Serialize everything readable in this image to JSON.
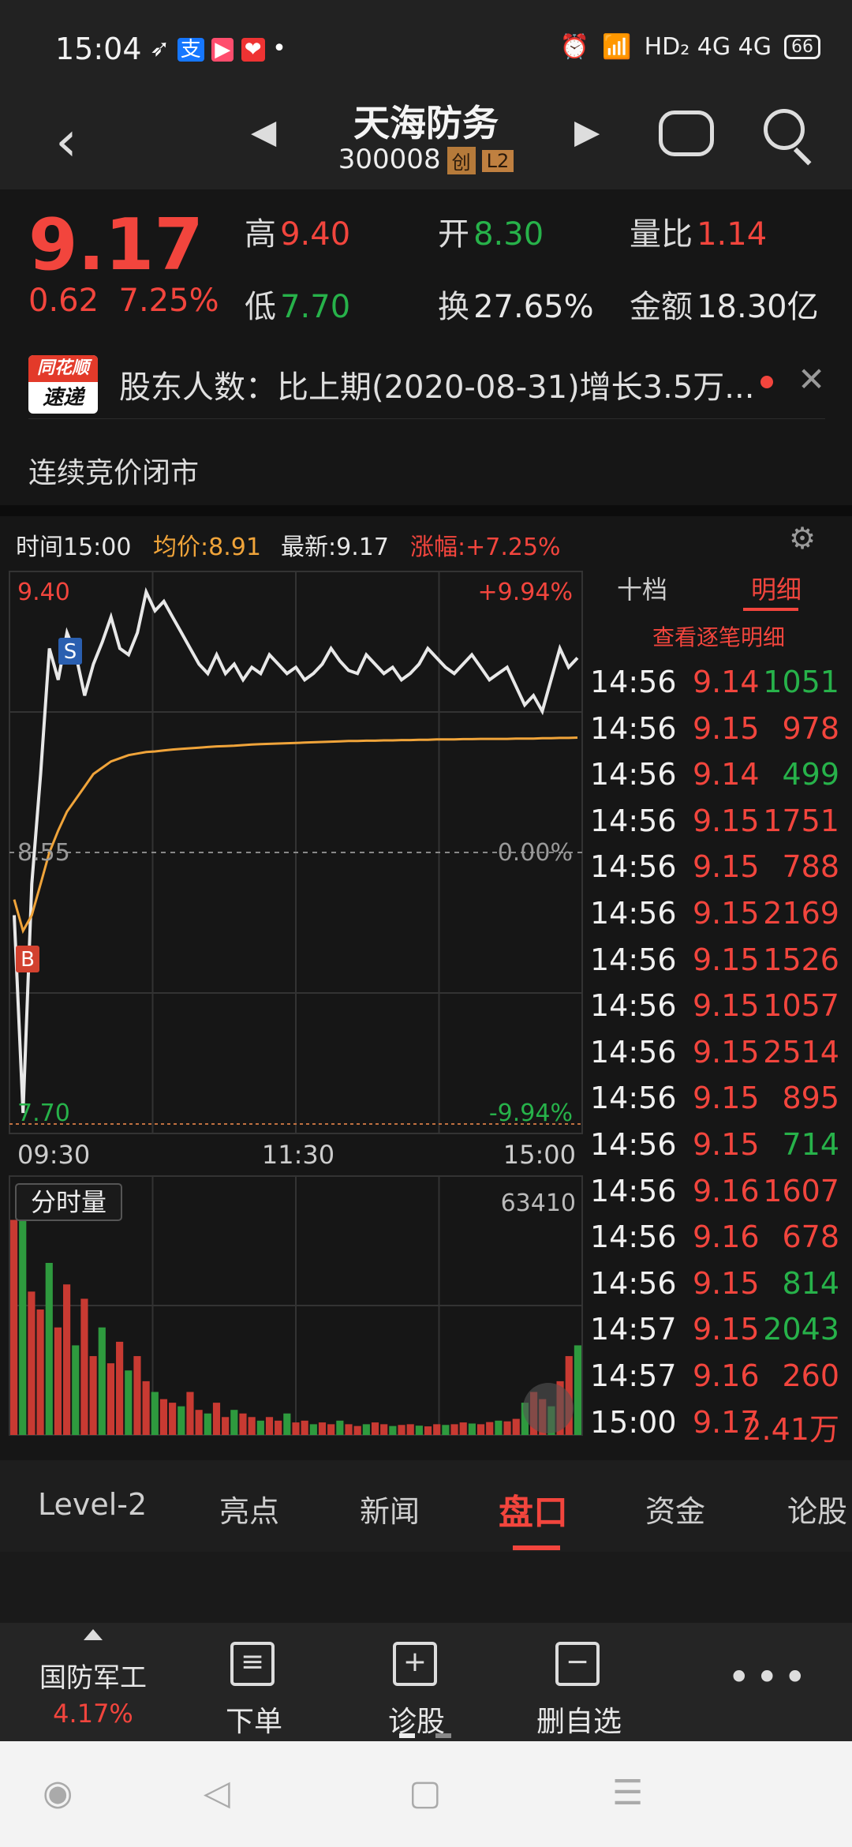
{
  "status_bar": {
    "time": "15:04",
    "network": "HD₂ 4G 4G",
    "battery": "66"
  },
  "header": {
    "title": "天海防务",
    "code": "300008",
    "badge1": "创",
    "badge2": "L2"
  },
  "quote": {
    "price": "9.17",
    "change": "0.62",
    "change_pct": "7.25%",
    "high_label": "高",
    "high": "9.40",
    "open_label": "开",
    "open": "8.30",
    "volratio_label": "量比",
    "volratio": "1.14",
    "low_label": "低",
    "low": "7.70",
    "turnover_label": "换",
    "turnover": "27.65%",
    "amount_label": "金额",
    "amount": "18.30亿"
  },
  "news": {
    "logo_top": "同花顺",
    "logo_bottom": "速递",
    "text": "股东人数：比上期(2020-08-31)增长3.5万..."
  },
  "session_status": "连续竞价闭市",
  "chart_bar": {
    "time": "时间15:00",
    "avg": "均价:8.91",
    "latest": "最新:9.17",
    "pct": "涨幅:+7.25%"
  },
  "chart_labels": {
    "top_price": "9.40",
    "top_pct": "+9.94%",
    "mid_price": "8.55",
    "mid_pct": "0.00%",
    "bot_price": "7.70",
    "bot_pct": "-9.94%",
    "x_start": "09:30",
    "x_mid": "11:30",
    "x_end": "15:00",
    "vol_label": "分时量",
    "vol_max": "63410",
    "marker_b": "B",
    "marker_s": "S"
  },
  "chart_data": {
    "type": "line",
    "ylim": [
      7.7,
      9.4
    ],
    "series": [
      {
        "name": "",
        "color": "#e8e8e8",
        "values": [
          8.35,
          7.72,
          8.45,
          8.8,
          9.2,
          9.1,
          9.25,
          9.18,
          9.05,
          9.15,
          9.22,
          9.3,
          9.2,
          9.18,
          9.25,
          9.38,
          9.32,
          9.35,
          9.3,
          9.25,
          9.2,
          9.15,
          9.12,
          9.18,
          9.12,
          9.15,
          9.1,
          9.14,
          9.12,
          9.18,
          9.15,
          9.12,
          9.14,
          9.1,
          9.12,
          9.15,
          9.2,
          9.16,
          9.13,
          9.12,
          9.18,
          9.15,
          9.12,
          9.14,
          9.1,
          9.12,
          9.15,
          9.2,
          9.17,
          9.14,
          9.12,
          9.15,
          9.18,
          9.14,
          9.1,
          9.12,
          9.14,
          9.08,
          9.02,
          9.05,
          9.0,
          9.1,
          9.2,
          9.14,
          9.17
        ]
      },
      {
        "name": "",
        "color": "#f0a43a",
        "values": [
          8.4,
          8.3,
          8.35,
          8.45,
          8.55,
          8.62,
          8.68,
          8.72,
          8.76,
          8.8,
          8.82,
          8.84,
          8.85,
          8.86,
          8.865,
          8.87,
          8.872,
          8.875,
          8.878,
          8.88,
          8.882,
          8.884,
          8.886,
          8.888,
          8.889,
          8.89,
          8.892,
          8.894,
          8.895,
          8.896,
          8.897,
          8.898,
          8.899,
          8.9,
          8.901,
          8.902,
          8.903,
          8.904,
          8.905,
          8.905,
          8.906,
          8.906,
          8.907,
          8.907,
          8.908,
          8.908,
          8.909,
          8.909,
          8.91,
          8.91,
          8.91,
          8.911,
          8.911,
          8.912,
          8.912,
          8.912,
          8.912,
          8.913,
          8.913,
          8.913,
          8.914,
          8.914,
          8.915,
          8.915,
          8.916
        ]
      }
    ],
    "volume": [
      60000,
      63410,
      40000,
      35000,
      48000,
      30000,
      42000,
      25000,
      38000,
      22000,
      30000,
      20000,
      26000,
      18000,
      22000,
      15000,
      12000,
      10000,
      9000,
      8000,
      12000,
      7000,
      6000,
      9000,
      5000,
      7000,
      6000,
      5000,
      4000,
      5000,
      4000,
      6000,
      3500,
      4000,
      3000,
      3500,
      3000,
      4000,
      3000,
      2500,
      3000,
      3500,
      3000,
      2500,
      2800,
      3000,
      2600,
      2400,
      3000,
      2800,
      3000,
      3500,
      3200,
      3000,
      3600,
      4000,
      3800,
      4500,
      9000,
      12000,
      10000,
      8000,
      15000,
      22000,
      25000
    ]
  },
  "detail_tabs": {
    "ten": "十档",
    "detail": "明细",
    "view_all": "查看逐笔明细"
  },
  "trades": [
    {
      "time": "14:56",
      "price": "9.14",
      "vol": "1051",
      "c": "green"
    },
    {
      "time": "14:56",
      "price": "9.15",
      "vol": "978",
      "c": "red"
    },
    {
      "time": "14:56",
      "price": "9.14",
      "vol": "499",
      "c": "green"
    },
    {
      "time": "14:56",
      "price": "9.15",
      "vol": "1751",
      "c": "red"
    },
    {
      "time": "14:56",
      "price": "9.15",
      "vol": "788",
      "c": "red"
    },
    {
      "time": "14:56",
      "price": "9.15",
      "vol": "2169",
      "c": "red"
    },
    {
      "time": "14:56",
      "price": "9.15",
      "vol": "1526",
      "c": "red"
    },
    {
      "time": "14:56",
      "price": "9.15",
      "vol": "1057",
      "c": "red"
    },
    {
      "time": "14:56",
      "price": "9.15",
      "vol": "2514",
      "c": "red"
    },
    {
      "time": "14:56",
      "price": "9.15",
      "vol": "895",
      "c": "red"
    },
    {
      "time": "14:56",
      "price": "9.15",
      "vol": "714",
      "c": "green"
    },
    {
      "time": "14:56",
      "price": "9.16",
      "vol": "1607",
      "c": "red"
    },
    {
      "time": "14:56",
      "price": "9.16",
      "vol": "678",
      "c": "red"
    },
    {
      "time": "14:56",
      "price": "9.15",
      "vol": "814",
      "c": "green"
    },
    {
      "time": "14:57",
      "price": "9.15",
      "vol": "2043",
      "c": "green"
    },
    {
      "time": "14:57",
      "price": "9.16",
      "vol": "260",
      "c": "red"
    },
    {
      "time": "15:00",
      "price": "9.17",
      "vol": "2.41万",
      "c": "red"
    }
  ],
  "bottom_tabs": [
    "Level-2",
    "亮点",
    "新闻",
    "盘口",
    "资金",
    "论股"
  ],
  "toolbar": {
    "sector": "国防军工",
    "sector_pct": "4.17%",
    "order": "下单",
    "diagnose": "诊股",
    "remove": "删自选"
  }
}
